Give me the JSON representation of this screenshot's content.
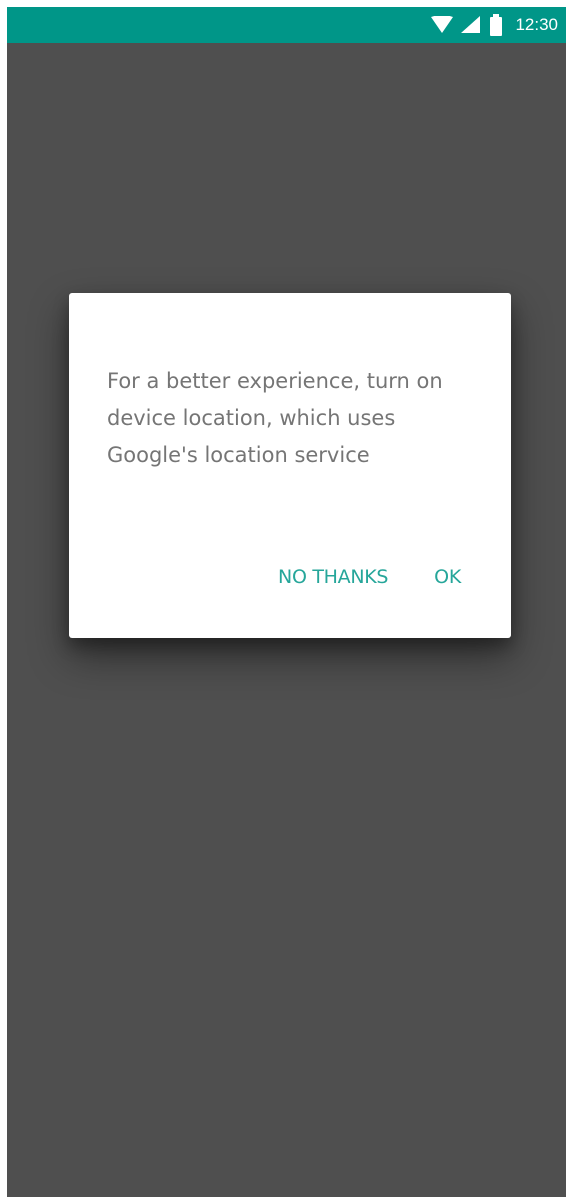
{
  "status_bar": {
    "time": "12:30",
    "icons": [
      "wifi-icon",
      "cellular-signal-icon",
      "battery-icon"
    ],
    "background_color": "#009688"
  },
  "screen": {
    "background_color": "#4f4f4f"
  },
  "dialog": {
    "message": "For a better experience, turn on device location, which uses Google's location service",
    "negative_button": "NO THANKS",
    "positive_button": "OK",
    "accent_color": "#26a69a"
  }
}
